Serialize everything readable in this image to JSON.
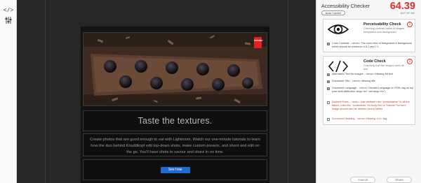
{
  "toolbar": {
    "items": [
      {
        "icon": "code-brackets-icon",
        "label": "</>"
      },
      {
        "icon": "sliders-icon"
      }
    ]
  },
  "email": {
    "hero_alt": "Chocolate tart with blackberries",
    "logo_text": "Adobe",
    "headline": "Taste the textures.",
    "body": "Create photos that are good enough to eat with Lightroom. Watch our one-minute tutorials to learn how the duo behind Knuddkopf edit top-down shots, make custom presets, and shoot and edit on the go. You'll have shots to savour and share in no time.",
    "cta": "See how"
  },
  "panel": {
    "title": "Accessibility Checker",
    "auto_correct": "Auto Correct",
    "score": "64.39",
    "score_sub": "OUT OF 100",
    "cards": [
      {
        "title": "Perceivability Check",
        "icon": "eye-icon",
        "description": "Checking contrast ratios of images, foreground and background",
        "items": [
          {
            "text": "Color Contrast - <error> The color ratio of foreground & background which should be minimum 4.5:1 and 7:1",
            "status": "pass"
          }
        ]
      },
      {
        "title": "Code Check",
        "icon": "code-icon",
        "description": "Checking if all the images have alt text",
        "items": [
          {
            "text": "Alternative Text for images - <error> Missing Alt text",
            "status": "pass"
          },
          {
            "text": "Document Title - <error> Missing title",
            "status": "pass"
          },
          {
            "text": "Document Language - <error> Declare Language in HTML tag on top (use both attributes: lang=\"en\" xml:lang=\"en\")",
            "status": "pass"
          },
          {
            "text": "Defined Roles - <error> Use attribute role=\"presentation\" in all the tables, roles like \"contentinfo\" for body text or \"banner\" for hero image should also be defined (accu) tables",
            "status": "fail"
          },
          {
            "text": "Document Heading - <error> Missing <h1> tag",
            "status": "fail"
          }
        ]
      }
    ],
    "buttons": {
      "cancel": "Cancel",
      "share": "Share"
    }
  },
  "colors": {
    "score": "#d0382e",
    "cta": "#1b6dd1",
    "canvas": "#262626",
    "fail_text": "#c2433a"
  }
}
